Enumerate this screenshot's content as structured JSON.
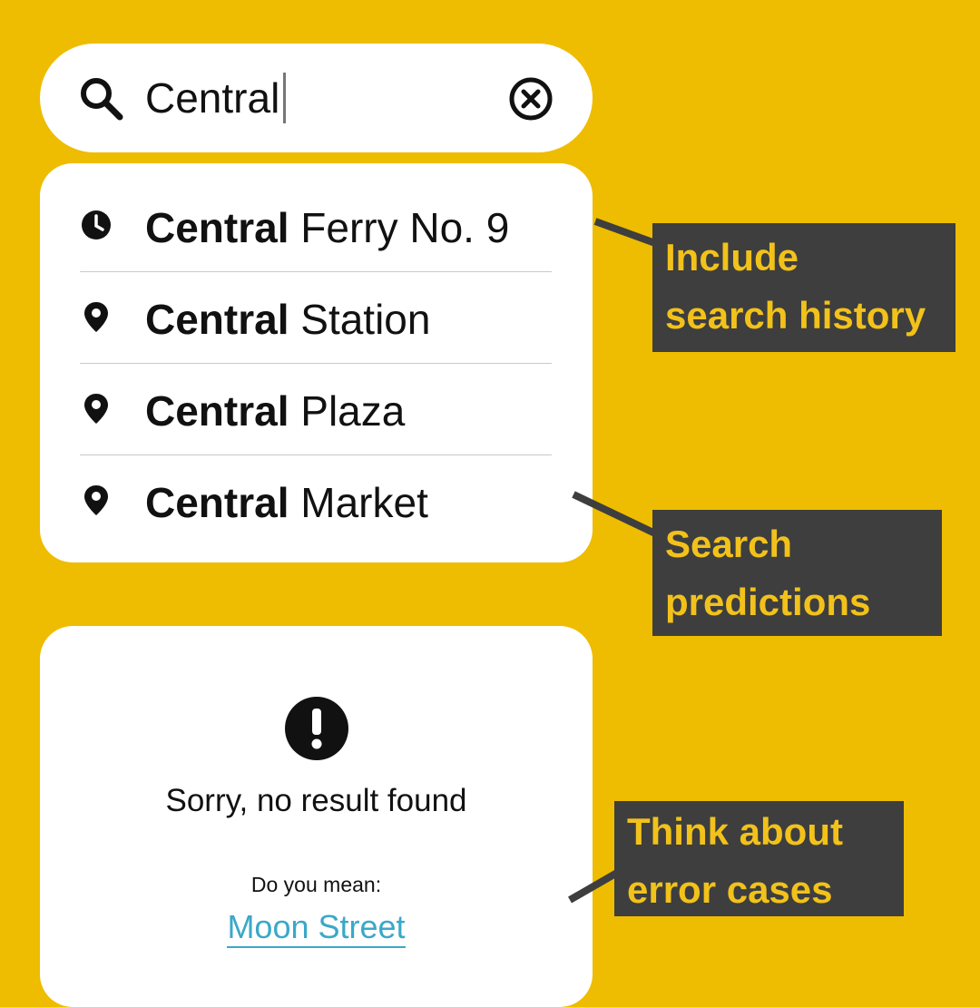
{
  "search": {
    "value": "Central",
    "icon": "search-icon",
    "clear_icon": "close-circle-icon"
  },
  "suggestions": [
    {
      "icon": "clock-icon",
      "bold": "Central",
      "rest": " Ferry No. 9"
    },
    {
      "icon": "location-pin-icon",
      "bold": "Central",
      "rest": " Station"
    },
    {
      "icon": "location-pin-icon",
      "bold": "Central",
      "rest": " Plaza"
    },
    {
      "icon": "location-pin-icon",
      "bold": "Central",
      "rest": " Market"
    }
  ],
  "empty_state": {
    "icon": "alert-icon",
    "message": "Sorry, no result found",
    "did_you_mean": "Do you mean:",
    "suggestion": "Moon Street"
  },
  "callouts": {
    "history": {
      "line1": "Include",
      "line2": "search history"
    },
    "predictions": {
      "line1": "Search",
      "line2": "predictions"
    },
    "errors": {
      "line1": "Think about",
      "line2": "error cases"
    }
  },
  "colors": {
    "background": "#EEBC00",
    "callout_bg": "#3E3E3E",
    "callout_text": "#F2C21B",
    "link": "#3BA8C8"
  }
}
